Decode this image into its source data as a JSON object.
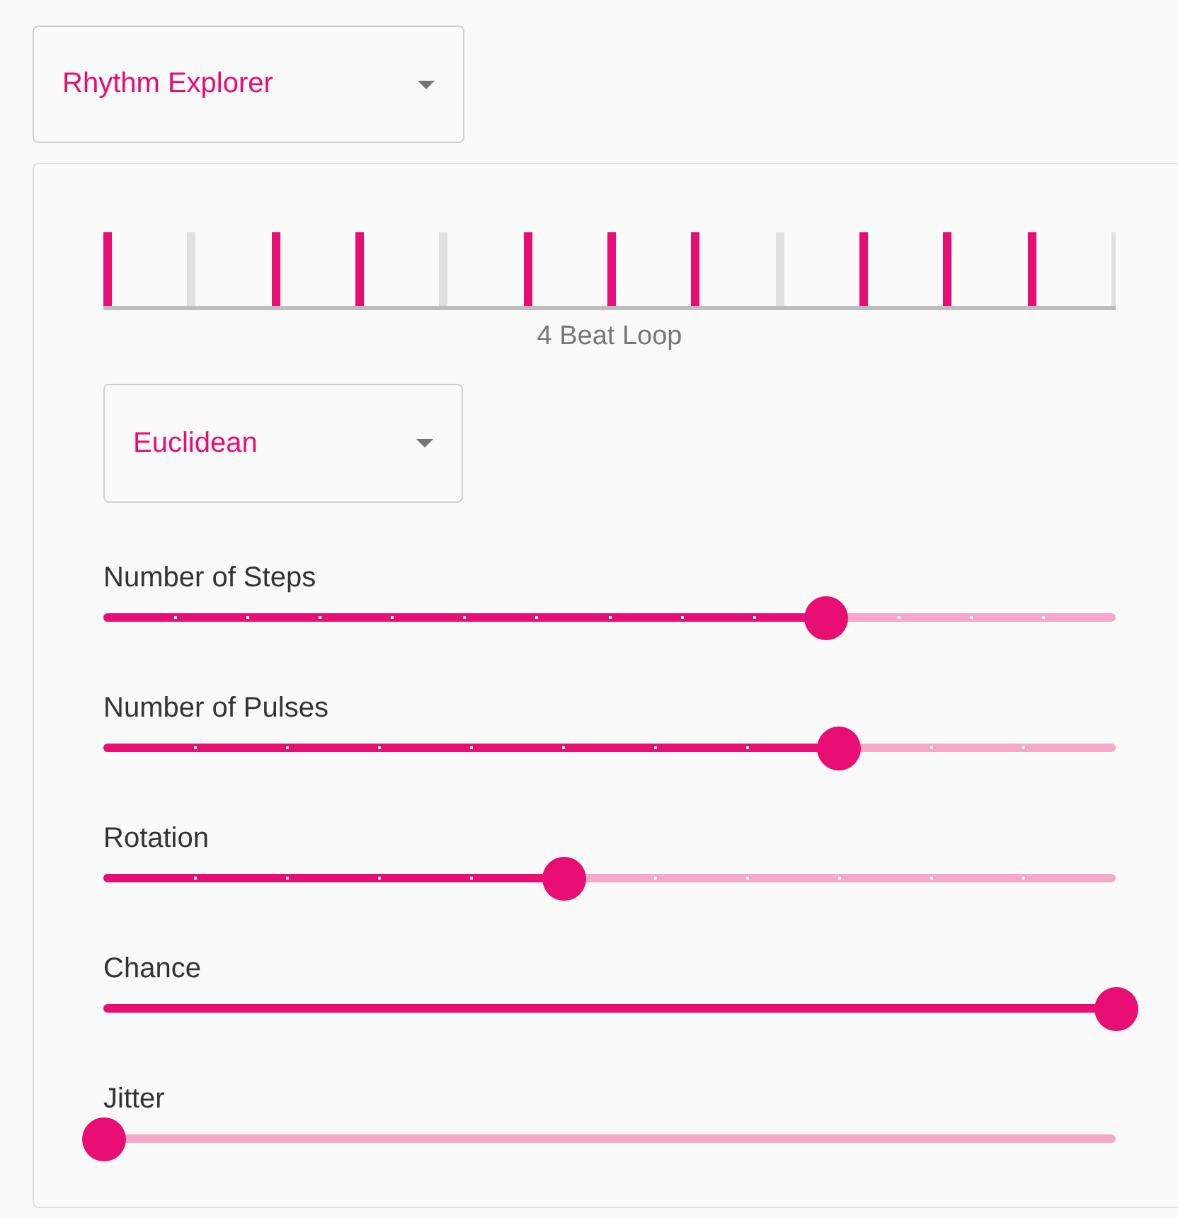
{
  "mode_select": {
    "value": "Rhythm Explorer"
  },
  "pattern": {
    "caption": "4 Beat Loop",
    "steps": [
      {
        "on": true
      },
      {
        "on": false
      },
      {
        "on": true
      },
      {
        "on": true
      },
      {
        "on": false
      },
      {
        "on": true
      },
      {
        "on": true
      },
      {
        "on": true
      },
      {
        "on": false
      },
      {
        "on": true
      },
      {
        "on": true
      },
      {
        "on": true
      }
    ]
  },
  "algorithm_select": {
    "value": "Euclidean"
  },
  "sliders": [
    {
      "label": "Number of Steps",
      "level": 0.714,
      "kind": "stepped"
    },
    {
      "label": "Number of Pulses",
      "level": 0.727,
      "kind": "stepped"
    },
    {
      "label": "Rotation",
      "level": 0.455,
      "kind": "stepped"
    },
    {
      "label": "Chance",
      "level": 1,
      "kind": "continuous"
    },
    {
      "label": "Jitter",
      "level": 0,
      "kind": "continuous"
    }
  ]
}
